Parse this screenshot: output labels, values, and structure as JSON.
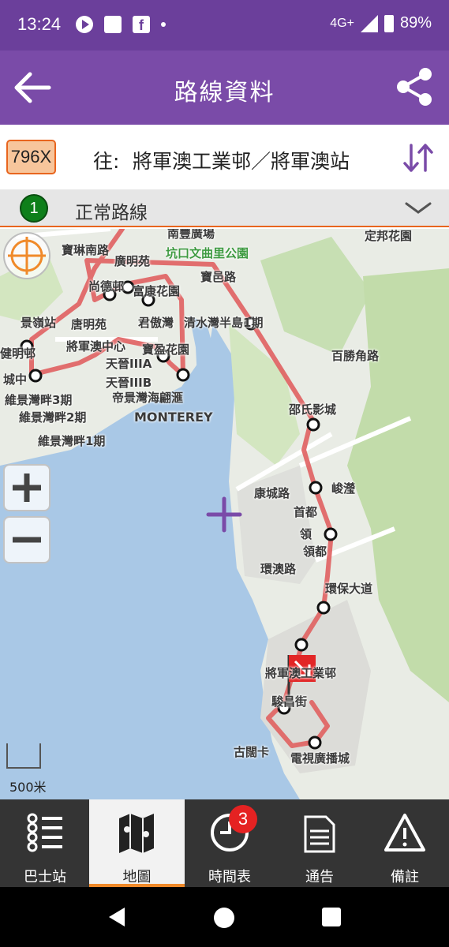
{
  "status_bar": {
    "time": "13:24",
    "network": "4G+",
    "battery": "89%"
  },
  "app_bar": {
    "title": "路線資料"
  },
  "route": {
    "number": "796X",
    "direction_label": "往:",
    "destination": "將軍澳工業邨／將軍澳站"
  },
  "variant": {
    "number": "1",
    "label": "正常路線"
  },
  "map": {
    "labels": [
      "南豐廣場",
      "定邦花園",
      "坑口文曲里公園",
      "廣明苑",
      "寶琳南路",
      "尚德邨",
      "富康花園",
      "唐明苑",
      "君傲灣",
      "清水灣半島1期",
      "將軍澳中心",
      "寶盈花園",
      "天晉IIIA",
      "天晉IIIB",
      "帝景灣海翩滙",
      "MONTEREY",
      "維景灣畔3期",
      "維景灣畔2期",
      "維景灣畔1期",
      "景嶺站",
      "健明邨",
      "城中",
      "百勝角路",
      "邵氏影城",
      "康城路",
      "峻瀅",
      "首都",
      "領",
      "領都",
      "環澳路",
      "環保大道",
      "將軍澳工業邨",
      "駿昌街",
      "古闊卡",
      "電視廣播城",
      "寶邑路"
    ],
    "scale_label": "500米"
  },
  "bottom_nav": {
    "items": [
      {
        "label": "巴士站",
        "icon": "stop-list-icon"
      },
      {
        "label": "地圖",
        "icon": "map-icon"
      },
      {
        "label": "時間表",
        "icon": "clock-icon"
      },
      {
        "label": "通告",
        "icon": "notice-icon"
      },
      {
        "label": "備註",
        "icon": "warning-icon"
      }
    ],
    "notice_badge": "3"
  },
  "colors": {
    "accent": "#7a4ba8",
    "status_bar": "#6b3f9b",
    "route_line": "#e06060",
    "active_tab_underline": "#f08a2a"
  }
}
